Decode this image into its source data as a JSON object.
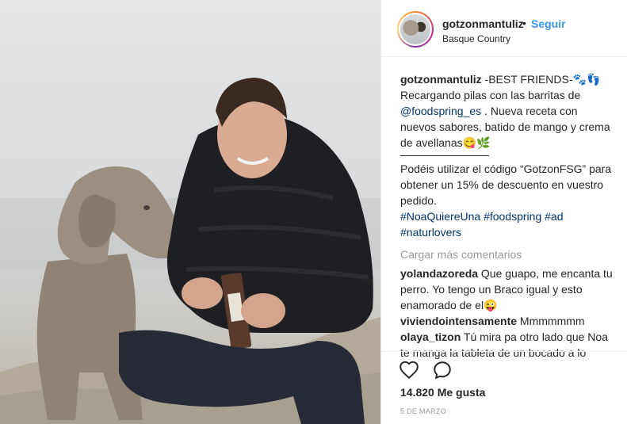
{
  "header": {
    "username": "gotzonmantuliz",
    "separator": "•",
    "follow_label": "Seguir",
    "location": "Basque Country"
  },
  "caption": {
    "username": "gotzonmantuliz",
    "line1": " -BEST FRIENDS-🐾👣",
    "line2": "Recargando pilas con las barritas de",
    "mention": "@foodspring_es",
    "line3": " . Nueva receta con nuevos sabores, batido de mango y crema de avellanas😋🌿",
    "line4": "Podéis utilizar el código “GotzonFSG” para obtener un 15% de descuento en vuestro pedido.",
    "hashtags": [
      "#NoaQuiereUna",
      "#foodspring",
      "#ad",
      "#naturlovers"
    ]
  },
  "load_more_label": "Cargar más comentarios",
  "comments": [
    {
      "username": "yolandazoreda",
      "text": " Que guapo, me encanta tu perro. Yo tengo un Braco igual y esto enamorado de el😜"
    },
    {
      "username": "viviendointensamente",
      "text": " Mmmmmmm"
    },
    {
      "username": "olaya_tizon",
      "text": " Tú mira pa otro lado que Noa te manga la tableta de un bocado a lo"
    }
  ],
  "actions": {
    "like_icon": "heart-icon",
    "comment_icon": "comment-bubble-icon",
    "likes_text": "14.820 Me gusta",
    "date": "5 DE MARZO"
  },
  "colors": {
    "link": "#003569",
    "follow": "#3897f0",
    "muted": "#999999",
    "text": "#262626"
  }
}
